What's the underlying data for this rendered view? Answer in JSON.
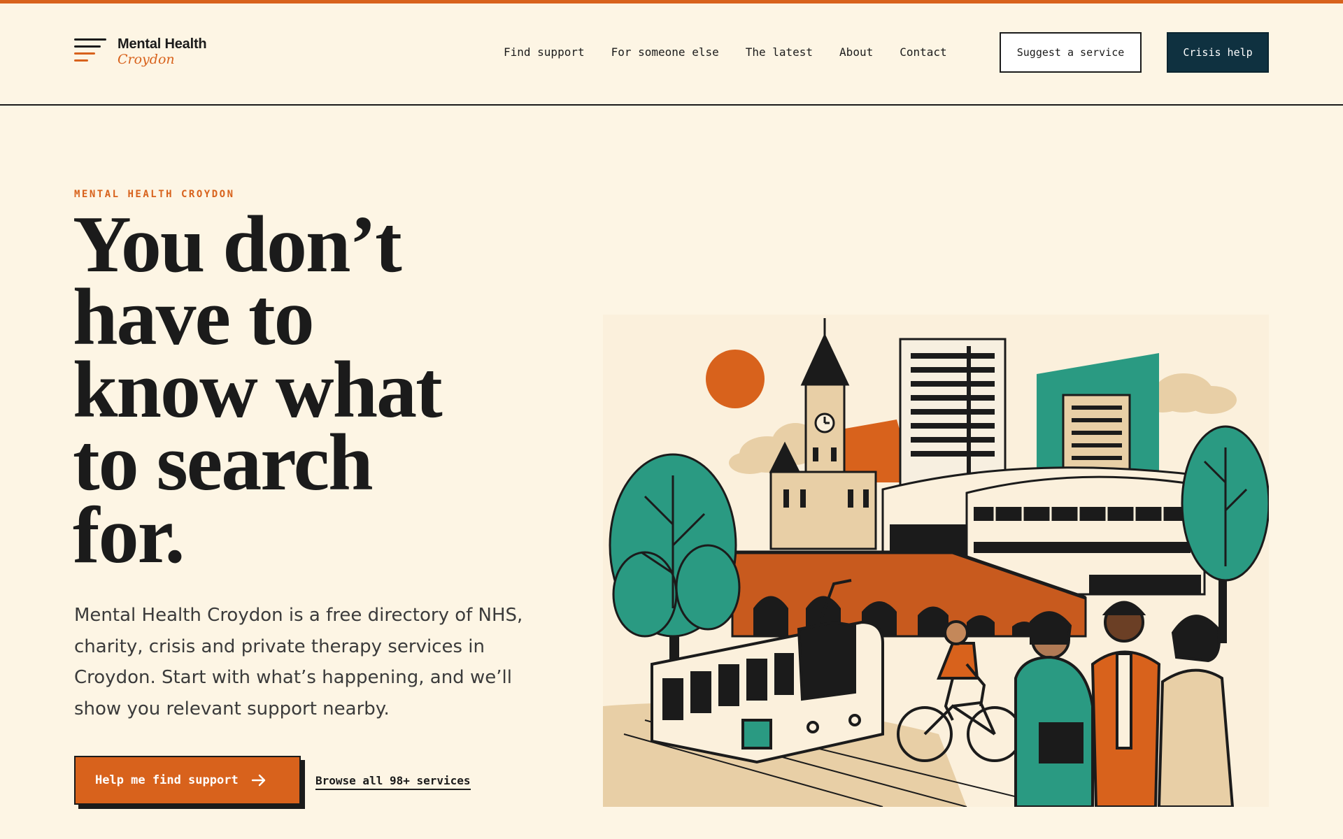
{
  "header": {
    "logo": {
      "title": "Mental Health",
      "subtitle": "Croydon"
    },
    "nav": [
      {
        "label": "Find support"
      },
      {
        "label": "For someone else"
      },
      {
        "label": "The latest"
      },
      {
        "label": "About"
      },
      {
        "label": "Contact"
      }
    ],
    "suggest_label": "Suggest a service",
    "crisis_label": "Crisis help"
  },
  "hero": {
    "eyebrow": "MENTAL HEALTH CROYDON",
    "headline_lines": [
      "You don’t",
      "have to",
      "know what",
      "to search",
      "for."
    ],
    "intro_lines": [
      "Mental Health Croydon is a free directory of NHS,",
      "charity, crisis and private therapy services in",
      "Croydon. Start with what’s happening, and we’ll",
      "show you relevant support nearby."
    ],
    "primary_cta": "Help me find support",
    "secondary_link": "Browse all 98+ services"
  },
  "illustration": {
    "subject": "Croydon cityscape: clock tower, tower blocks, brick viaduct, tram, cyclist, group of people, trees"
  },
  "colors": {
    "background": "#fdf5e4",
    "accent": "#d8621c",
    "ink": "#1b1b1b",
    "dark_teal": "#0f3140",
    "teal": "#2a9a82",
    "beige": "#e8cfa6"
  }
}
